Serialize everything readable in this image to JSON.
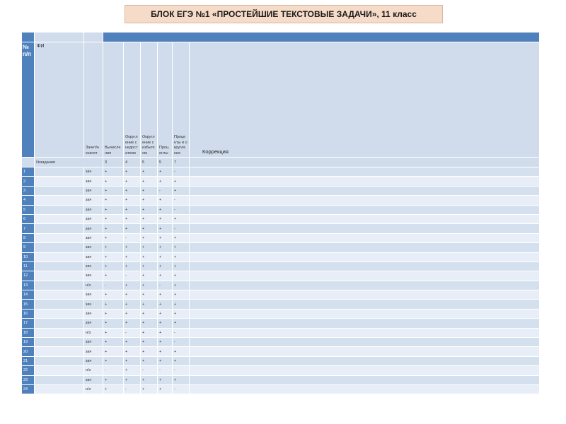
{
  "title": "БЛОК ЕГЭ №1 «ПРОСТЕЙШИЕ ТЕКСТОВЫЕ ЗАДАЧИ», 11  класс",
  "header": {
    "num_label": "№ п/п",
    "fi_label": "ФИ",
    "columns": [
      "Зачет/незачет",
      "Вычисления",
      "Округление с недостатком",
      "Округление с избытком",
      "Проценты",
      "Проценты и округление"
    ],
    "correction_label": "Коррекция",
    "task_row_label": "№задания",
    "task_numbers": [
      "3",
      "4",
      "5",
      "5",
      "7"
    ]
  },
  "rows": [
    {
      "n": "1",
      "status": "зач",
      "marks": [
        "+",
        "+",
        "+",
        "+",
        "-"
      ]
    },
    {
      "n": "2",
      "status": "зач",
      "marks": [
        "+",
        "+",
        "+",
        "+",
        "+"
      ]
    },
    {
      "n": "3",
      "status": "зач",
      "marks": [
        "+",
        "+",
        "+",
        "-",
        "+"
      ]
    },
    {
      "n": "4",
      "status": "зач",
      "marks": [
        "+",
        "+",
        "+",
        "+",
        "-"
      ]
    },
    {
      "n": "5",
      "status": "зач",
      "marks": [
        "+",
        "+",
        "+",
        "+",
        "-"
      ]
    },
    {
      "n": "6",
      "status": "зач",
      "marks": [
        "+",
        "+",
        "+",
        "+",
        "+"
      ]
    },
    {
      "n": "7",
      "status": "зач",
      "marks": [
        "+",
        "+",
        "+",
        "+",
        "-"
      ]
    },
    {
      "n": "8",
      "status": "зач",
      "marks": [
        "+",
        "-",
        "+",
        "+",
        "+"
      ]
    },
    {
      "n": "9",
      "status": "зач",
      "marks": [
        "+",
        "+",
        "+",
        "+",
        "+"
      ]
    },
    {
      "n": "10",
      "status": "зач",
      "marks": [
        "+",
        "+",
        "+",
        "+",
        "+"
      ]
    },
    {
      "n": "11",
      "status": "зач",
      "marks": [
        "+",
        "+",
        "+",
        "+",
        "+"
      ]
    },
    {
      "n": "12",
      "status": "зач",
      "marks": [
        "+",
        "-",
        "+",
        "+",
        "+"
      ]
    },
    {
      "n": "13",
      "status": "н/з",
      "marks": [
        "-",
        "+",
        "+",
        "-",
        "+"
      ]
    },
    {
      "n": "14",
      "status": "зач",
      "marks": [
        "+",
        "+",
        "+",
        "+",
        "+"
      ]
    },
    {
      "n": "15",
      "status": "зач",
      "marks": [
        "+",
        "+",
        "+",
        "+",
        "+"
      ]
    },
    {
      "n": "16",
      "status": "зач",
      "marks": [
        "+",
        "+",
        "+",
        "+",
        "+"
      ]
    },
    {
      "n": "17",
      "status": "зач",
      "marks": [
        "+",
        "+",
        "+",
        "+",
        "+"
      ]
    },
    {
      "n": "18",
      "status": "н/з",
      "marks": [
        "+",
        "-",
        "+",
        "+",
        "-"
      ]
    },
    {
      "n": "19",
      "status": "зач",
      "marks": [
        "+",
        "+",
        "+",
        "+",
        "-"
      ]
    },
    {
      "n": "20",
      "status": "зач",
      "marks": [
        "+",
        "+",
        "+",
        "+",
        "+"
      ]
    },
    {
      "n": "21",
      "status": "зач",
      "marks": [
        "+",
        "+",
        "+",
        "+",
        "+"
      ]
    },
    {
      "n": "22",
      "status": "н/з",
      "marks": [
        "-",
        "+",
        "-",
        "-",
        "-"
      ]
    },
    {
      "n": "23",
      "status": "зач",
      "marks": [
        "+",
        "+",
        "+",
        "+",
        "+"
      ]
    },
    {
      "n": "24",
      "status": "н/з",
      "marks": [
        "+",
        "-",
        "+",
        "+",
        "-"
      ]
    }
  ]
}
